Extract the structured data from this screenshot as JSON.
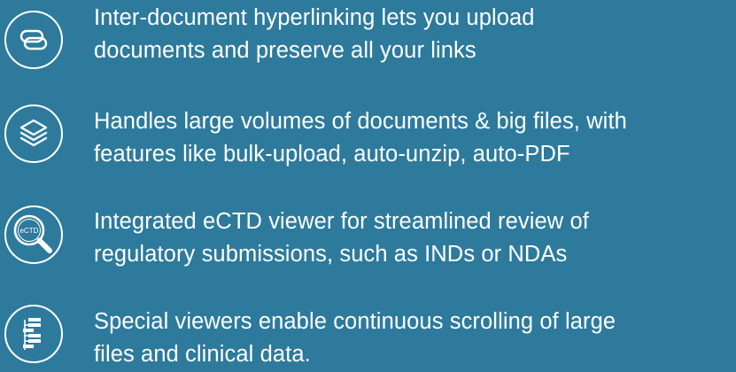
{
  "features": [
    {
      "icon": "link-icon",
      "line1": "Inter-document hyperlinking lets you upload",
      "line2": "documents and preserve all your links"
    },
    {
      "icon": "layers-icon",
      "line1": "Handles large volumes of documents & big files, with",
      "line2": "features like bulk-upload, auto-unzip, auto-PDF"
    },
    {
      "icon": "magnifier-icon",
      "icon_label": "eCTD",
      "line1": "Integrated eCTD viewer for streamlined review of",
      "line2": "regulatory submissions, such as INDs or NDAs"
    },
    {
      "icon": "file-tree-icon",
      "line1": "Special viewers enable continuous scrolling of large",
      "line2": "files and clinical data."
    }
  ],
  "colors": {
    "background": "#2d7a9c",
    "foreground": "#ffffff"
  }
}
